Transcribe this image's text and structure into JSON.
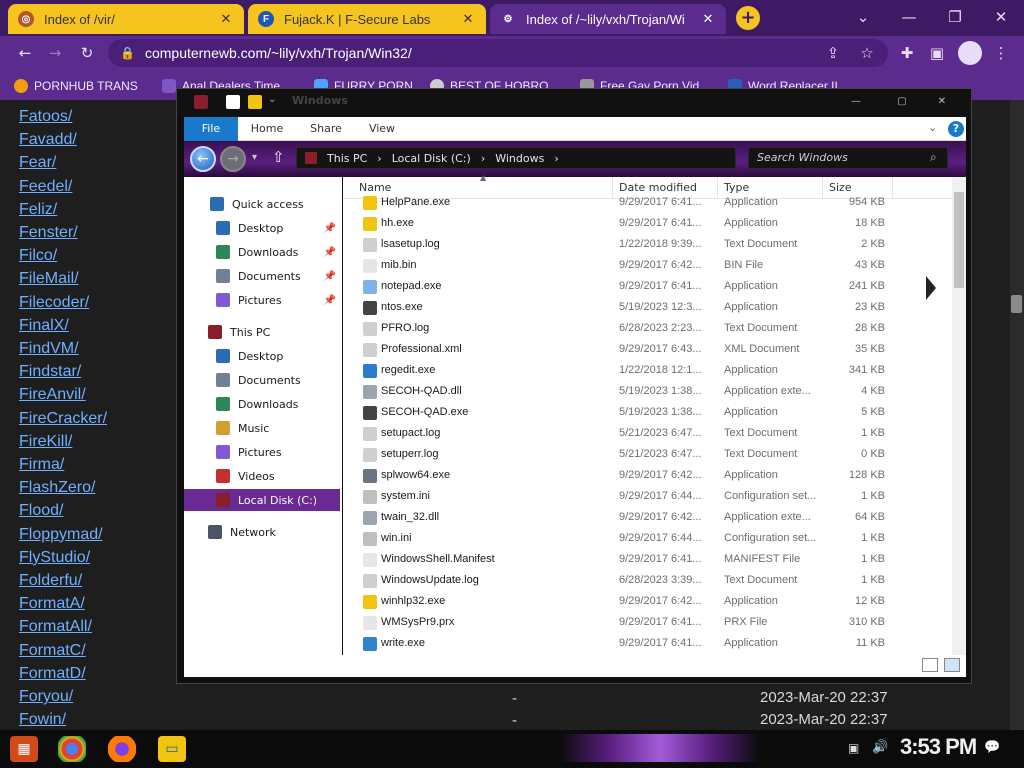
{
  "browser": {
    "tabs": [
      {
        "title": "Index of /vir/",
        "active": false
      },
      {
        "title": "Fujack.K | F-Secure Labs",
        "active": false
      },
      {
        "title": "Index of /~lily/vxh/Trojan/Wi",
        "active": true
      }
    ],
    "new_tab": "+",
    "address": "computernewb.com/~lily/vxh/Trojan/Win32/",
    "bookmarks": [
      "PORNHUB TRANS",
      "Anal Dealers Time",
      "FURRY PORN",
      "BEST OF HOBRO",
      "Free Gay Porn Vid",
      "Word Replacer II"
    ]
  },
  "page": {
    "links": [
      "Fatoos/",
      "Favadd/",
      "Fear/",
      "Feedel/",
      "Feliz/",
      "Fenster/",
      "Filco/",
      "FileMail/",
      "Filecoder/",
      "FinalX/",
      "FindVM/",
      "Findstar/",
      "FireAnvil/",
      "FireCracker/",
      "FireKill/",
      "Firma/",
      "FlashZero/",
      "Flood/",
      "Floppymad/",
      "FlyStudio/",
      "Folderfu/",
      "FormatA/",
      "FormatAll/",
      "FormatC/",
      "FormatD/",
      "Foryou/",
      "Fowin/"
    ],
    "row_dash": "-",
    "row_dates": [
      "2023-Mar-20 22:37",
      "2023-Mar-20 22:37"
    ]
  },
  "explorer": {
    "title": "Windows",
    "ribbon": {
      "file": "File",
      "tabs": [
        "Home",
        "Share",
        "View"
      ]
    },
    "breadcrumb": [
      "This PC",
      "Local Disk (C:)",
      "Windows"
    ],
    "search_placeholder": "Search Windows",
    "nav": {
      "quick_access": "Quick access",
      "quick_items": [
        "Desktop",
        "Downloads",
        "Documents",
        "Pictures"
      ],
      "this_pc": "This PC",
      "pc_items": [
        "Desktop",
        "Documents",
        "Downloads",
        "Music",
        "Pictures",
        "Videos",
        "Local Disk (C:)"
      ],
      "network": "Network"
    },
    "columns": {
      "name": "Name",
      "date": "Date modified",
      "type": "Type",
      "size": "Size"
    },
    "files": [
      {
        "name": "HelpPane.exe",
        "date": "9/29/2017 6:41...",
        "type": "Application",
        "size": "954 KB",
        "icon": "help-icon"
      },
      {
        "name": "hh.exe",
        "date": "9/29/2017 6:41...",
        "type": "Application",
        "size": "18 KB",
        "icon": "help-icon"
      },
      {
        "name": "lsasetup.log",
        "date": "1/22/2018 9:39...",
        "type": "Text Document",
        "size": "2 KB",
        "icon": "document-icon"
      },
      {
        "name": "mib.bin",
        "date": "9/29/2017 6:42...",
        "type": "BIN File",
        "size": "43 KB",
        "icon": "file-icon"
      },
      {
        "name": "notepad.exe",
        "date": "9/29/2017 6:41...",
        "type": "Application",
        "size": "241 KB",
        "icon": "notepad-icon"
      },
      {
        "name": "ntos.exe",
        "date": "5/19/2023 12:3...",
        "type": "Application",
        "size": "23 KB",
        "icon": "app-icon"
      },
      {
        "name": "PFRO.log",
        "date": "6/28/2023 2:23...",
        "type": "Text Document",
        "size": "28 KB",
        "icon": "document-icon"
      },
      {
        "name": "Professional.xml",
        "date": "9/29/2017 6:43...",
        "type": "XML Document",
        "size": "35 KB",
        "icon": "document-icon"
      },
      {
        "name": "regedit.exe",
        "date": "1/22/2018 12:1...",
        "type": "Application",
        "size": "341 KB",
        "icon": "registry-icon"
      },
      {
        "name": "SECOH-QAD.dll",
        "date": "5/19/2023 1:38...",
        "type": "Application exte...",
        "size": "4 KB",
        "icon": "dll-icon"
      },
      {
        "name": "SECOH-QAD.exe",
        "date": "5/19/2023 1:38...",
        "type": "Application",
        "size": "5 KB",
        "icon": "app-icon"
      },
      {
        "name": "setupact.log",
        "date": "5/21/2023 6:47...",
        "type": "Text Document",
        "size": "1 KB",
        "icon": "document-icon"
      },
      {
        "name": "setuperr.log",
        "date": "5/21/2023 6:47...",
        "type": "Text Document",
        "size": "0 KB",
        "icon": "document-icon"
      },
      {
        "name": "splwow64.exe",
        "date": "9/29/2017 6:42...",
        "type": "Application",
        "size": "128 KB",
        "icon": "printer-icon"
      },
      {
        "name": "system.ini",
        "date": "9/29/2017 6:44...",
        "type": "Configuration set...",
        "size": "1 KB",
        "icon": "config-icon"
      },
      {
        "name": "twain_32.dll",
        "date": "9/29/2017 6:42...",
        "type": "Application exte...",
        "size": "64 KB",
        "icon": "dll-icon"
      },
      {
        "name": "win.ini",
        "date": "9/29/2017 6:44...",
        "type": "Configuration set...",
        "size": "1 KB",
        "icon": "config-icon"
      },
      {
        "name": "WindowsShell.Manifest",
        "date": "9/29/2017 6:41...",
        "type": "MANIFEST File",
        "size": "1 KB",
        "icon": "file-icon"
      },
      {
        "name": "WindowsUpdate.log",
        "date": "6/28/2023 3:39...",
        "type": "Text Document",
        "size": "1 KB",
        "icon": "document-icon"
      },
      {
        "name": "winhlp32.exe",
        "date": "9/29/2017 6:42...",
        "type": "Application",
        "size": "12 KB",
        "icon": "help-icon"
      },
      {
        "name": "WMSysPr9.prx",
        "date": "9/29/2017 6:41...",
        "type": "PRX File",
        "size": "310 KB",
        "icon": "file-icon"
      },
      {
        "name": "write.exe",
        "date": "9/29/2017 6:41...",
        "type": "Application",
        "size": "11 KB",
        "icon": "wordpad-icon"
      }
    ]
  },
  "taskbar": {
    "clock": "3:53 PM"
  },
  "colors": {
    "accent": "#5b2b8e",
    "tab_yellow": "#f5c41f",
    "link": "#6fb0ff",
    "selection": "#6a2a93",
    "file_tab": "#1979ca"
  }
}
